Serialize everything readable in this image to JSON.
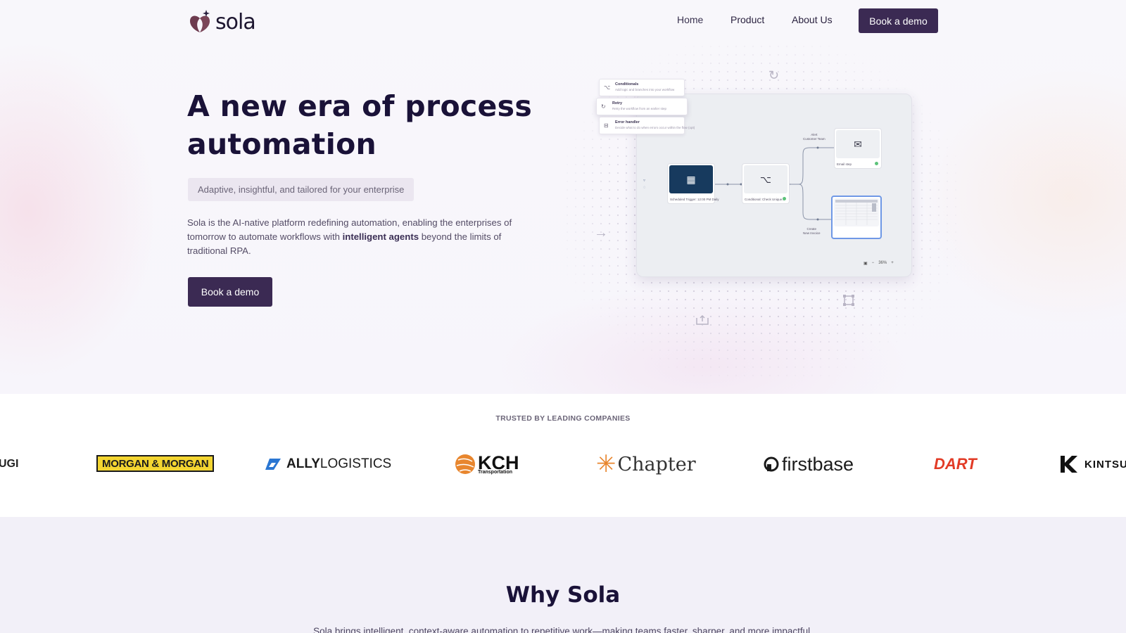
{
  "header": {
    "brand": "sola",
    "nav": [
      "Home",
      "Product",
      "About Us"
    ],
    "cta": "Book a demo"
  },
  "hero": {
    "title": "A new era of process automation",
    "tagline": "Adaptive, insightful, and tailored for your enterprise",
    "body_pre": "Sola is the AI-native platform redefining automation, enabling the enterprises of tomorrow to automate workflows with ",
    "body_bold": "intelligent agents",
    "body_post": " beyond the limits of traditional RPA.",
    "cta": "Book a demo"
  },
  "illustration": {
    "menu": [
      {
        "icon": "branch-icon",
        "title": "Conditionals",
        "desc": "Add logic and branches into your workflow"
      },
      {
        "icon": "retry-icon",
        "title": "Retry",
        "desc": "Retry the workflow from an earlier step"
      },
      {
        "icon": "error-icon",
        "title": "Error handler",
        "desc": "Decide what to do when errors occur within the flow (opt)"
      }
    ],
    "nodes": {
      "schedule": "Scheduled Trigger: 12:00 PM Daily",
      "conditional": "Conditional: Check Unique...",
      "email": "Email step",
      "create": ""
    },
    "edge_labels": {
      "top": "Alert\nCustomer Team",
      "bottom": "Create\nNew Invoice"
    },
    "zoom": "36%"
  },
  "trusted": {
    "title": "TRUSTED BY LEADING COMPANIES",
    "logos": {
      "ugi": "UGI",
      "morgan": "MORGAN & MORGAN",
      "ally_bold": "ALLY",
      "ally_rest": "LOGISTICS",
      "kch": "KCH",
      "kch_sub": "Transportation",
      "chapter": "Chapter",
      "firstbase": "firstbase",
      "dart": "DART",
      "kintsugi": "KINTSU"
    }
  },
  "why": {
    "title": "Why Sola",
    "subtitle": "Sola brings intelligent, context-aware automation to repetitive work—making teams faster, sharper, and more impactful."
  },
  "colors": {
    "brand_dark": "#3b2a53",
    "title": "#1a1238",
    "schedule_node": "#173a5e",
    "dart_red": "#e23b26",
    "morgan_yellow": "#f3d531"
  }
}
